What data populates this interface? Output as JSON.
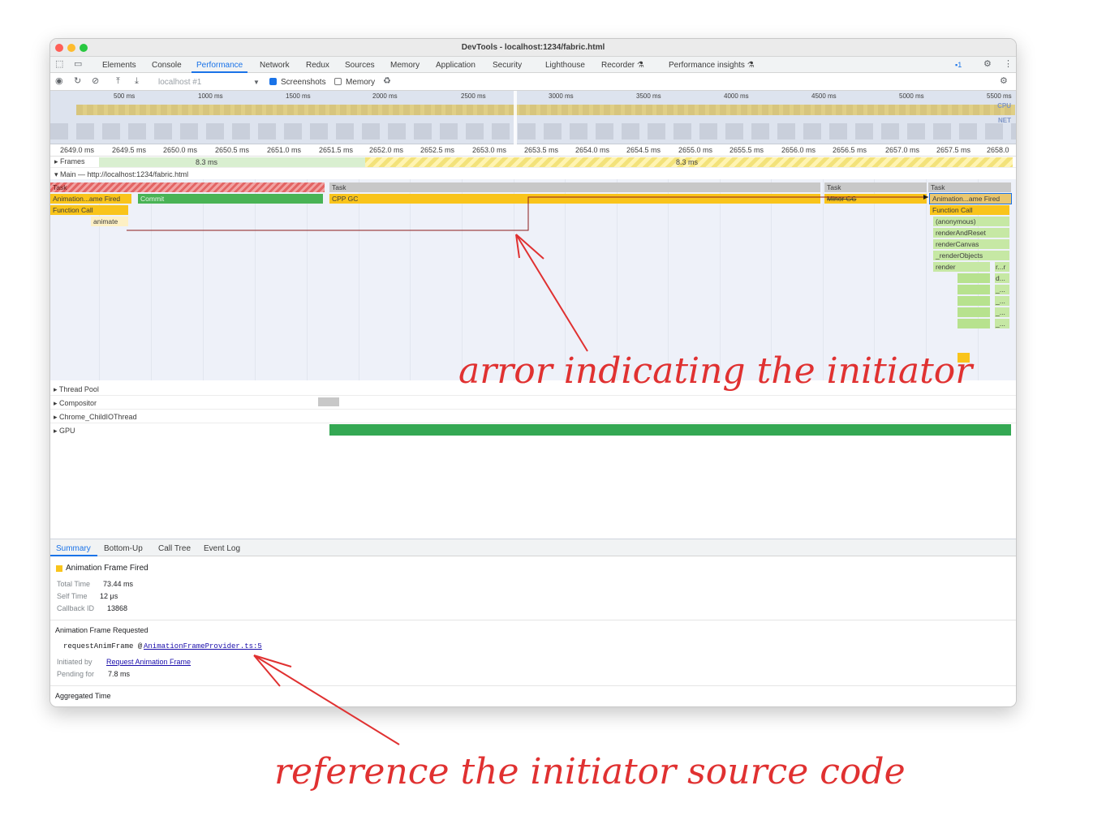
{
  "window": {
    "title": "DevTools - localhost:1234/fabric.html"
  },
  "tabs": [
    "Elements",
    "Console",
    "Performance",
    "Network",
    "Redux",
    "Sources",
    "Memory",
    "Application",
    "Security",
    "Lighthouse",
    "Recorder",
    "Performance insights"
  ],
  "tabs_flask": "⚗",
  "issues_badge": "1",
  "toolbar": {
    "profile_select": "localhost #1",
    "screenshots_label": "Screenshots",
    "memory_label": "Memory",
    "screenshots_checked": true,
    "memory_checked": false
  },
  "overview": {
    "ticks": [
      "500 ms",
      "1000 ms",
      "1500 ms",
      "2000 ms",
      "2500 ms",
      "3000 ms",
      "3500 ms",
      "4000 ms",
      "4500 ms",
      "5000 ms",
      "5500 ms"
    ],
    "cpu_label": "CPU",
    "net_label": "NET"
  },
  "ruler": [
    "2649.0 ms",
    "2649.5 ms",
    "2650.0 ms",
    "2650.5 ms",
    "2651.0 ms",
    "2651.5 ms",
    "2652.0 ms",
    "2652.5 ms",
    "2653.0 ms",
    "2653.5 ms",
    "2654.0 ms",
    "2654.5 ms",
    "2655.0 ms",
    "2655.5 ms",
    "2656.0 ms",
    "2656.5 ms",
    "2657.0 ms",
    "2657.5 ms",
    "2658.0"
  ],
  "frames": {
    "label": "Frames",
    "frame1": "8.3 ms",
    "frame2": "8.3 ms"
  },
  "main": {
    "label": "Main — http://localhost:1234/fabric.html",
    "task": "Task",
    "animation_fired": "Animation...ame Fired",
    "commit": "Commit",
    "function_call": "Function Call",
    "animate": "animate",
    "cpp_gc": "CPP GC",
    "minor_gc": "Minor GC",
    "stack": [
      "(anonymous)",
      "renderAndReset",
      "renderCanvas",
      "_renderObjects",
      "render"
    ],
    "tiny": [
      "r...r",
      "d...",
      "_...",
      "_...",
      "_...",
      "_..."
    ]
  },
  "threads": [
    "Thread Pool",
    "Compositor",
    "Chrome_ChildIOThread",
    "GPU"
  ],
  "bottom_tabs": [
    "Summary",
    "Bottom-Up",
    "Call Tree",
    "Event Log"
  ],
  "summary": {
    "title": "Animation Frame Fired",
    "total_time_label": "Total Time",
    "total_time": "73.44 ms",
    "self_time_label": "Self Time",
    "self_time": "12 μs",
    "callback_label": "Callback ID",
    "callback_id": "13868",
    "requested_title": "Animation Frame Requested",
    "stack_fn": "requestAnimFrame @ ",
    "stack_link": "AnimationFrameProvider.ts:5",
    "initiated_label": "Initiated by",
    "initiated_value": "Request Animation Frame",
    "pending_label": "Pending for",
    "pending_value": "7.8 ms",
    "aggregated": "Aggregated Time"
  },
  "annotations": {
    "arrow1": "arror indicating the initiator",
    "arrow2": "reference the initiator source code"
  },
  "colors": {
    "accent": "#1a73e8",
    "task_yellow": "#f9c41b",
    "task_green": "#49b355",
    "annotation": "#e03131"
  }
}
